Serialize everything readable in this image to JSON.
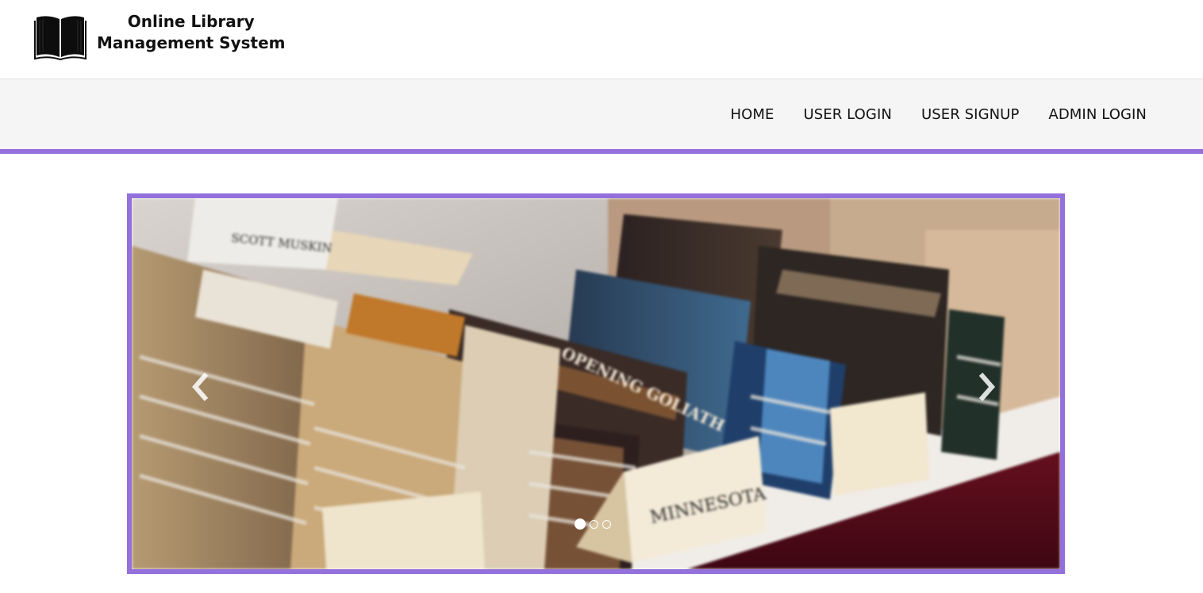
{
  "brand": {
    "line1": "Online Library",
    "line2": "Management System",
    "icon": "open-book-icon"
  },
  "nav": [
    {
      "label": "HOME"
    },
    {
      "label": "USER LOGIN"
    },
    {
      "label": "USER SIGNUP"
    },
    {
      "label": "ADMIN LOGIN"
    }
  ],
  "colors": {
    "accent": "#9370db",
    "navbar_bg": "#f5f5f5",
    "header_bg": "#ffffff"
  },
  "carousel": {
    "slide_count": 3,
    "active_slide": 1,
    "prev_icon": "chevron-left-icon",
    "next_icon": "chevron-right-icon",
    "tent_cards": [
      {
        "text": "SCOTT MUSKIN"
      },
      {
        "text": "OPENING GOLIATH"
      },
      {
        "text": "MINNESOTA"
      }
    ]
  }
}
